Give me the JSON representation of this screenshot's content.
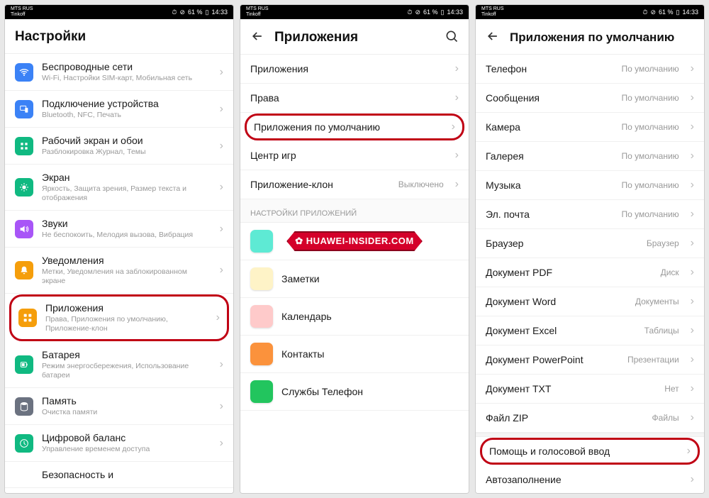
{
  "statusbar": {
    "carrier1": "MTS RUS",
    "carrier2": "Tinkoff",
    "battery": "61 %",
    "time": "14:33"
  },
  "screen1": {
    "title": "Настройки",
    "items": [
      {
        "label": "Беспроводные сети",
        "sub": "Wi-Fi, Настройки SIM-карт, Мобильная сеть",
        "icon": "wifi",
        "color": "#3b82f6"
      },
      {
        "label": "Подключение устройства",
        "sub": "Bluetooth, NFC, Печать",
        "icon": "device",
        "color": "#3b82f6"
      },
      {
        "label": "Рабочий экран и обои",
        "sub": "Разблокировка Журнал, Темы",
        "icon": "home",
        "color": "#10b981"
      },
      {
        "label": "Экран",
        "sub": "Яркость, Защита зрения, Размер текста и отображения",
        "icon": "display",
        "color": "#10b981"
      },
      {
        "label": "Звуки",
        "sub": "Не беспокоить, Мелодия вызова, Вибрация",
        "icon": "sound",
        "color": "#a855f7"
      },
      {
        "label": "Уведомления",
        "sub": "Метки, Уведомления на заблокированном экране",
        "icon": "bell",
        "color": "#f59e0b"
      },
      {
        "label": "Приложения",
        "sub": "Права, Приложения по умолчанию, Приложение-клон",
        "icon": "apps",
        "color": "#f59e0b",
        "highlight": true
      },
      {
        "label": "Батарея",
        "sub": "Режим энергосбережения, Использование батареи",
        "icon": "battery",
        "color": "#10b981"
      },
      {
        "label": "Память",
        "sub": "Очистка памяти",
        "icon": "storage",
        "color": "#6b7280"
      },
      {
        "label": "Цифровой баланс",
        "sub": "Управление временем доступа",
        "icon": "balance",
        "color": "#10b981"
      },
      {
        "label": "Безопасность и",
        "sub": "",
        "icon": "",
        "color": ""
      }
    ]
  },
  "screen2": {
    "title": "Приложения",
    "items": [
      {
        "label": "Приложения"
      },
      {
        "label": "Права"
      },
      {
        "label": "Приложения по умолчанию",
        "highlight": true
      },
      {
        "label": "Центр игр"
      },
      {
        "label": "Приложение-клон",
        "value": "Выключено"
      }
    ],
    "section_header": "НАСТРОЙКИ ПРИЛОЖЕНИЙ",
    "apps": [
      {
        "label": "",
        "color": "#5eead4",
        "watermark": true
      },
      {
        "label": "Заметки",
        "color": "#fef3c7"
      },
      {
        "label": "Календарь",
        "color": "#fecaca"
      },
      {
        "label": "Контакты",
        "color": "#fb923c"
      },
      {
        "label": "Службы Телефон",
        "color": "#22c55e"
      }
    ],
    "watermark_text": "HUAWEI-INSIDER.COM"
  },
  "screen3": {
    "title": "Приложения по умолчанию",
    "items": [
      {
        "label": "Телефон",
        "value": "По умолчанию"
      },
      {
        "label": "Сообщения",
        "value": "По умолчанию"
      },
      {
        "label": "Камера",
        "value": "По умолчанию"
      },
      {
        "label": "Галерея",
        "value": "По умолчанию"
      },
      {
        "label": "Музыка",
        "value": "По умолчанию"
      },
      {
        "label": "Эл. почта",
        "value": "По умолчанию"
      },
      {
        "label": "Браузер",
        "value": "Браузер"
      },
      {
        "label": "Документ PDF",
        "value": "Диск"
      },
      {
        "label": "Документ Word",
        "value": "Документы"
      },
      {
        "label": "Документ Excel",
        "value": "Таблицы"
      },
      {
        "label": "Документ PowerPoint",
        "value": "Презентации"
      },
      {
        "label": "Документ TXT",
        "value": "Нет"
      },
      {
        "label": "Файл ZIP",
        "value": "Файлы"
      },
      {
        "label": "Помощь и голосовой ввод",
        "value": "",
        "highlight": true
      },
      {
        "label": "Автозаполнение",
        "value": ""
      }
    ]
  }
}
